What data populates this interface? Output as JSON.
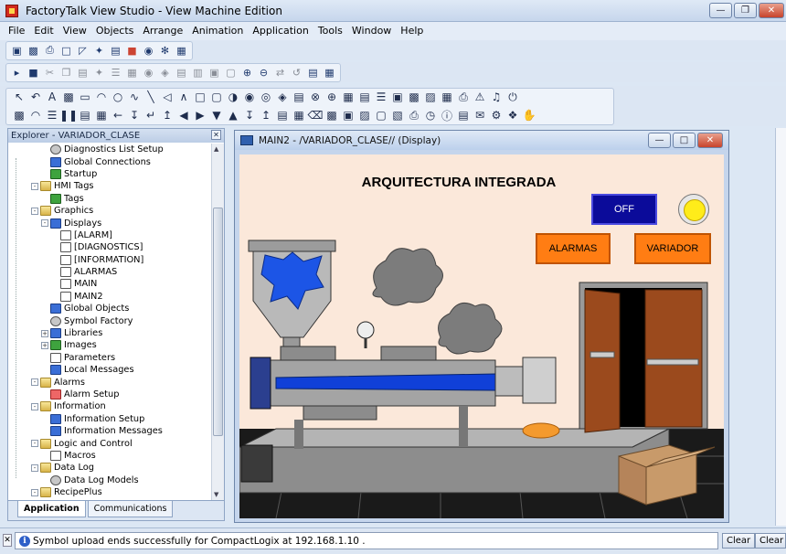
{
  "app": {
    "title": "FactoryTalk View Studio - View Machine Edition"
  },
  "menu": [
    "File",
    "Edit",
    "View",
    "Objects",
    "Arrange",
    "Animation",
    "Application",
    "Tools",
    "Window",
    "Help"
  ],
  "explorer": {
    "title": "Explorer - VARIADOR_CLASE",
    "items": [
      {
        "label": "Diagnostics List Setup",
        "level": 3,
        "icon": "gear",
        "expander": ""
      },
      {
        "label": "Global Connections",
        "level": 3,
        "icon": "blue",
        "expander": ""
      },
      {
        "label": "Startup",
        "level": 3,
        "icon": "green",
        "expander": ""
      },
      {
        "label": "HMI Tags",
        "level": 2,
        "icon": "folder",
        "expander": "-"
      },
      {
        "label": "Tags",
        "level": 3,
        "icon": "green",
        "expander": ""
      },
      {
        "label": "Graphics",
        "level": 2,
        "icon": "folder",
        "expander": "-"
      },
      {
        "label": "Displays",
        "level": 3,
        "icon": "blue",
        "expander": "-"
      },
      {
        "label": "[ALARM]",
        "level": 4,
        "icon": "doc",
        "expander": ""
      },
      {
        "label": "[DIAGNOSTICS]",
        "level": 4,
        "icon": "doc",
        "expander": ""
      },
      {
        "label": "[INFORMATION]",
        "level": 4,
        "icon": "doc",
        "expander": ""
      },
      {
        "label": "ALARMAS",
        "level": 4,
        "icon": "doc",
        "expander": ""
      },
      {
        "label": "MAIN",
        "level": 4,
        "icon": "doc",
        "expander": ""
      },
      {
        "label": "MAIN2",
        "level": 4,
        "icon": "doc",
        "expander": ""
      },
      {
        "label": "Global Objects",
        "level": 3,
        "icon": "blue",
        "expander": ""
      },
      {
        "label": "Symbol Factory",
        "level": 3,
        "icon": "gear",
        "expander": ""
      },
      {
        "label": "Libraries",
        "level": 3,
        "icon": "blue",
        "expander": "+"
      },
      {
        "label": "Images",
        "level": 3,
        "icon": "green",
        "expander": "+"
      },
      {
        "label": "Parameters",
        "level": 3,
        "icon": "doc",
        "expander": ""
      },
      {
        "label": "Local Messages",
        "level": 3,
        "icon": "blue",
        "expander": ""
      },
      {
        "label": "Alarms",
        "level": 2,
        "icon": "folder",
        "expander": "-"
      },
      {
        "label": "Alarm Setup",
        "level": 3,
        "icon": "red",
        "expander": ""
      },
      {
        "label": "Information",
        "level": 2,
        "icon": "folder",
        "expander": "-"
      },
      {
        "label": "Information Setup",
        "level": 3,
        "icon": "blue",
        "expander": ""
      },
      {
        "label": "Information Messages",
        "level": 3,
        "icon": "blue",
        "expander": ""
      },
      {
        "label": "Logic and Control",
        "level": 2,
        "icon": "folder",
        "expander": "-"
      },
      {
        "label": "Macros",
        "level": 3,
        "icon": "doc",
        "expander": ""
      },
      {
        "label": "Data Log",
        "level": 2,
        "icon": "folder",
        "expander": "-"
      },
      {
        "label": "Data Log Models",
        "level": 3,
        "icon": "gear",
        "expander": ""
      },
      {
        "label": "RecipePlus",
        "level": 2,
        "icon": "folder",
        "expander": "-"
      }
    ],
    "tabs": [
      "Application",
      "Communications"
    ]
  },
  "display": {
    "window_title": "MAIN2 - /VARIADOR_CLASE// (Display)",
    "heading": "ARQUITECTURA INTEGRADA",
    "off_label": "OFF",
    "alarmas_label": "ALARMAS",
    "variador_label": "VARIADOR"
  },
  "status": {
    "message": "Symbol upload ends successfully for CompactLogix at 192.168.1.10 .",
    "clear_label": "Clear",
    "clear_all_label": "Clear All"
  },
  "colors": {
    "canvas_bg": "#fbe8da",
    "off_button": "#0b0b9a",
    "orange_button": "#ff7d13",
    "lamp": "#ffec1a"
  }
}
